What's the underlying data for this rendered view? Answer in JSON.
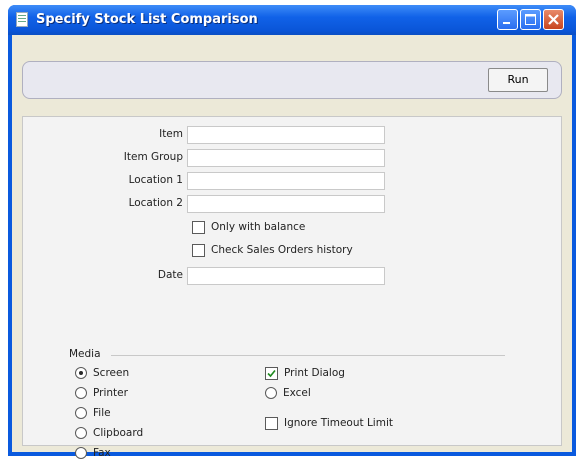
{
  "window": {
    "title": "Specify Stock List Comparison"
  },
  "toolbar": {
    "run_label": "Run"
  },
  "fields": [
    {
      "label": "Item",
      "value": ""
    },
    {
      "label": "Item Group",
      "value": ""
    },
    {
      "label": "Location 1",
      "value": ""
    },
    {
      "label": "Location 2",
      "value": ""
    }
  ],
  "options": {
    "only_with_balance": {
      "label": "Only with balance",
      "checked": false
    },
    "check_sales_orders_history": {
      "label": "Check Sales Orders history",
      "checked": false
    }
  },
  "date": {
    "label": "Date",
    "value": ""
  },
  "media": {
    "title": "Media",
    "destinations": [
      {
        "label": "Screen",
        "selected": true
      },
      {
        "label": "Printer",
        "selected": false
      },
      {
        "label": "File",
        "selected": false
      },
      {
        "label": "Clipboard",
        "selected": false
      },
      {
        "label": "Fax",
        "selected": false
      }
    ],
    "print_dialog": {
      "label": "Print Dialog",
      "checked": true
    },
    "excel": {
      "label": "Excel",
      "selected": false
    },
    "ignore_timeout": {
      "label": "Ignore Timeout Limit",
      "checked": false
    }
  },
  "colors": {
    "titlebar": "#0a5ade",
    "client": "#ece9d8",
    "panel": "#f3f3f3"
  }
}
